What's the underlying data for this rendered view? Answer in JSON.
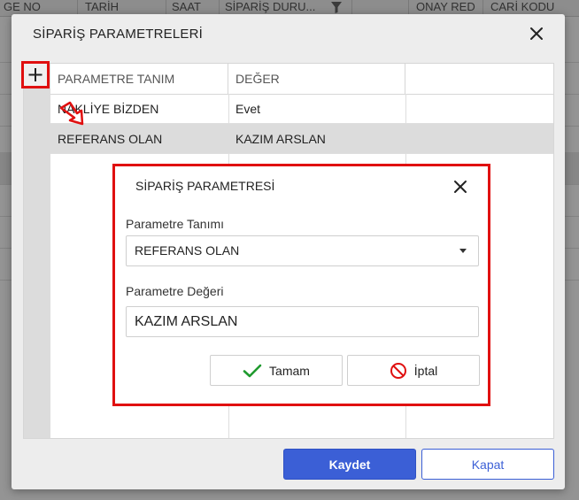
{
  "background": {
    "columns": [
      "GE NO",
      "TARİH",
      "SAAT",
      "SİPARİŞ DURU...",
      "",
      "ONAY RED",
      "CARİ KODU"
    ]
  },
  "dialog": {
    "title": "SİPARİŞ PARAMETRELERİ",
    "close_icon": "close-icon",
    "grid": {
      "add_icon": "plus-icon",
      "headers": [
        "PARAMETRE TANIM",
        "DEĞER",
        ""
      ],
      "rows": [
        {
          "name": "NAKLİYE BİZDEN",
          "value": "Evet"
        },
        {
          "name": "REFERANS OLAN",
          "value": "KAZIM ARSLAN"
        }
      ]
    },
    "save_label": "Kaydet",
    "close_label": "Kapat",
    "accent_color": "#3b5fd6",
    "highlight_color": "#e01010"
  },
  "param_dialog": {
    "title": "SİPARİŞ PARAMETRESİ",
    "definition_label": "Parametre Tanımı",
    "definition_value": "REFERANS OLAN",
    "value_label": "Parametre Değeri",
    "value_value": "KAZIM ARSLAN",
    "ok_label": "Tamam",
    "cancel_label": "İptal",
    "ok_icon": "check-icon",
    "cancel_icon": "prohibited-icon"
  }
}
